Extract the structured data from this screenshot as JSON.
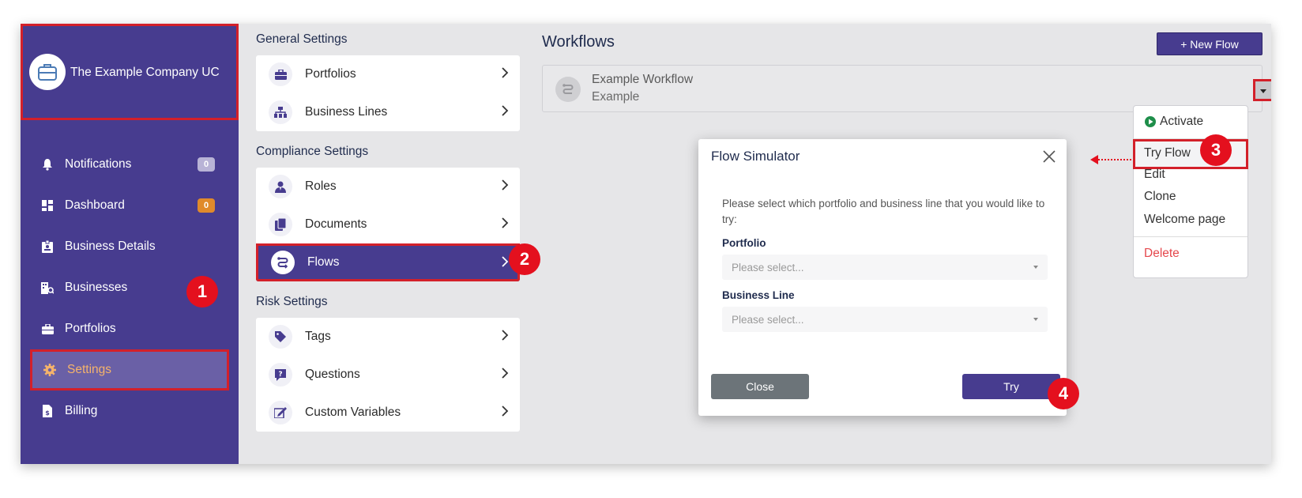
{
  "company": {
    "name": "The Example Company UC",
    "logo_icon": "briefcase-icon"
  },
  "sidebar": {
    "items": [
      {
        "label": "Notifications",
        "icon": "bell-icon",
        "badge": "0",
        "badge_color": "#b8b3d6"
      },
      {
        "label": "Dashboard",
        "icon": "dashboard-icon",
        "badge": "0",
        "badge_color": "#e08a2b"
      },
      {
        "label": "Business Details",
        "icon": "id-badge-icon"
      },
      {
        "label": "Businesses",
        "icon": "building-search-icon"
      },
      {
        "label": "Portfolios",
        "icon": "briefcase-icon"
      },
      {
        "label": "Settings",
        "icon": "gear-icon",
        "active": true
      },
      {
        "label": "Billing",
        "icon": "invoice-icon"
      }
    ]
  },
  "settings": {
    "general": {
      "title": "General Settings",
      "items": [
        {
          "label": "Portfolios",
          "icon": "briefcase-icon"
        },
        {
          "label": "Business Lines",
          "icon": "network-icon"
        }
      ]
    },
    "compliance": {
      "title": "Compliance Settings",
      "items": [
        {
          "label": "Roles",
          "icon": "user-tie-icon"
        },
        {
          "label": "Documents",
          "icon": "documents-icon"
        },
        {
          "label": "Flows",
          "icon": "flow-icon",
          "active": true
        }
      ]
    },
    "risk": {
      "title": "Risk Settings",
      "items": [
        {
          "label": "Tags",
          "icon": "tag-icon"
        },
        {
          "label": "Questions",
          "icon": "question-icon"
        },
        {
          "label": "Custom Variables",
          "icon": "edit-variable-icon"
        }
      ]
    }
  },
  "main": {
    "title": "Workflows",
    "new_flow_label": "+ New Flow",
    "workflow": {
      "name": "Example Workflow",
      "subtitle": "Example"
    }
  },
  "dropdown": {
    "activate": "Activate",
    "try_flow": "Try Flow",
    "edit": "Edit",
    "clone": "Clone",
    "welcome_page": "Welcome page",
    "delete": "Delete",
    "delete_color": "#e5484d"
  },
  "modal": {
    "title": "Flow Simulator",
    "description": "Please select which portfolio and business line that you would like to try:",
    "portfolio_label": "Portfolio",
    "portfolio_placeholder": "Please select...",
    "business_line_label": "Business Line",
    "business_line_placeholder": "Please select...",
    "close_label": "Close",
    "try_label": "Try"
  },
  "callouts": [
    "1",
    "2",
    "3",
    "4"
  ],
  "colors": {
    "brand": "#473c8f",
    "highlight": "#d3202a",
    "active_text": "#f5b36b"
  }
}
